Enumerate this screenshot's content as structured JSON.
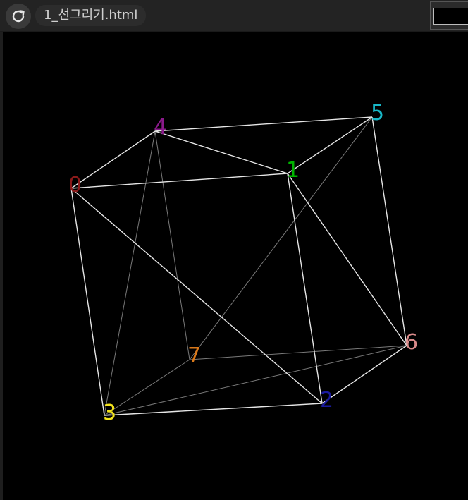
{
  "header": {
    "tab_title": "1_선그리기.html",
    "reload_icon": "reload-icon"
  },
  "diagram": {
    "vertices": [
      {
        "id": "0",
        "label": "0",
        "color": "#8b1a1a"
      },
      {
        "id": "1",
        "label": "1",
        "color": "#00b300"
      },
      {
        "id": "2",
        "label": "2",
        "color": "#1a1a9e"
      },
      {
        "id": "3",
        "label": "3",
        "color": "#f2e21b"
      },
      {
        "id": "4",
        "label": "4",
        "color": "#8b1a8b"
      },
      {
        "id": "5",
        "label": "5",
        "color": "#18b8c8"
      },
      {
        "id": "6",
        "label": "6",
        "color": "#d98a8a"
      },
      {
        "id": "7",
        "label": "7",
        "color": "#d9781a"
      }
    ],
    "edges": [
      {
        "from": "0",
        "to": "1",
        "weight": "bright"
      },
      {
        "from": "0",
        "to": "4",
        "weight": "bright"
      },
      {
        "from": "0",
        "to": "3",
        "weight": "bright"
      },
      {
        "from": "0",
        "to": "2",
        "weight": "bright"
      },
      {
        "from": "4",
        "to": "5",
        "weight": "bright"
      },
      {
        "from": "4",
        "to": "1",
        "weight": "bright"
      },
      {
        "from": "1",
        "to": "5",
        "weight": "bright"
      },
      {
        "from": "1",
        "to": "2",
        "weight": "bright"
      },
      {
        "from": "1",
        "to": "6",
        "weight": "bright"
      },
      {
        "from": "5",
        "to": "6",
        "weight": "bright"
      },
      {
        "from": "3",
        "to": "2",
        "weight": "bright"
      },
      {
        "from": "2",
        "to": "6",
        "weight": "bright"
      },
      {
        "from": "4",
        "to": "3",
        "weight": "dim"
      },
      {
        "from": "4",
        "to": "7",
        "weight": "dim"
      },
      {
        "from": "5",
        "to": "7",
        "weight": "dim"
      },
      {
        "from": "3",
        "to": "7",
        "weight": "dim"
      },
      {
        "from": "7",
        "to": "6",
        "weight": "dim"
      },
      {
        "from": "3",
        "to": "6",
        "weight": "dim"
      }
    ],
    "colors": {
      "bright_edge": "#e6e6e6",
      "dim_edge": "#7a7a7a",
      "background": "#000000"
    }
  }
}
